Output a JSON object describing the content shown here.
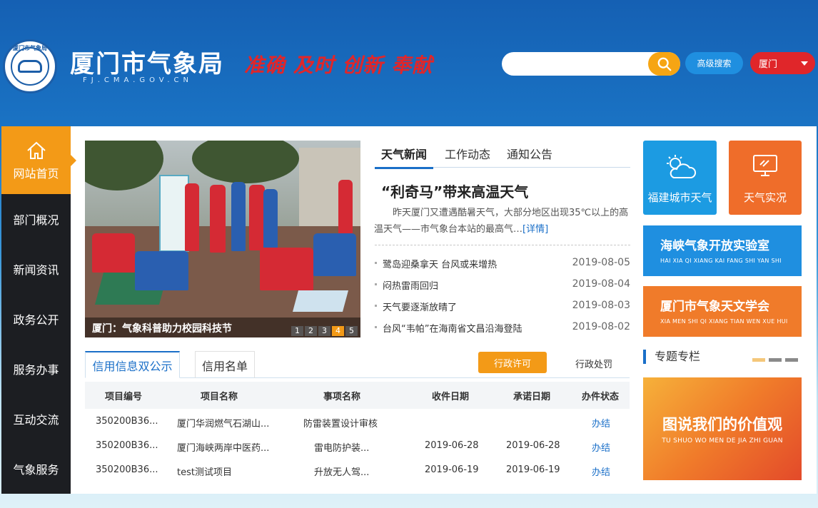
{
  "header": {
    "logo_ring_text": "厦门市气象局",
    "title": "厦门市气象局",
    "domain": "FJ.CMA.GOV.CN",
    "slogan": "准确 及时 创新 奉献",
    "search": {
      "placeholder": "",
      "value": ""
    },
    "advanced_search_label": "高级搜索",
    "city_selector": "厦门"
  },
  "sidebar": {
    "items": [
      {
        "label": "网站首页"
      },
      {
        "label": "部门概况"
      },
      {
        "label": "新闻资讯"
      },
      {
        "label": "政务公开"
      },
      {
        "label": "服务办事"
      },
      {
        "label": "互动交流"
      },
      {
        "label": "气象服务"
      }
    ]
  },
  "slider": {
    "caption": "厦门：气象科普助力校园科技节",
    "pages": [
      "1",
      "2",
      "3",
      "4",
      "5"
    ],
    "active_page": 4
  },
  "news": {
    "tabs": [
      "天气新闻",
      "工作动态",
      "通知公告"
    ],
    "headline": "“利奇马”带来高温天气",
    "summary": "昨天厦门又遭遇酷暑天气，大部分地区出现35℃以上的高温天气——市气象台本站的最高气…",
    "more_label": "[详情]",
    "items": [
      {
        "title": "鹭岛迎桑拿天 台风或来增热",
        "date": "2019-08-05"
      },
      {
        "title": "闷热雷雨回归",
        "date": "2019-08-04"
      },
      {
        "title": "天气要逐渐放晴了",
        "date": "2019-08-03"
      },
      {
        "title": "台风“韦帕”在海南省文昌沿海登陆",
        "date": "2019-08-02"
      }
    ]
  },
  "credit": {
    "tabs": [
      "信用信息双公示",
      "信用名单"
    ],
    "permit_button": "行政许可",
    "punish_link": "行政处罚",
    "columns": [
      "项目编号",
      "项目名称",
      "事项名称",
      "收件日期",
      "承诺日期",
      "办件状态"
    ],
    "rows": [
      [
        "350200B36...",
        "厦门华润燃气石湖山...",
        "防雷装置设计审核",
        "",
        "",
        "办结"
      ],
      [
        "350200B36...",
        "厦门海峡两岸中医药...",
        "雷电防护装...",
        "2019-06-28",
        "2019-06-28",
        "办结"
      ],
      [
        "350200B36...",
        "test测试项目",
        "升放无人驾...",
        "2019-06-19",
        "2019-06-19",
        "办结"
      ]
    ]
  },
  "right": {
    "tiles": [
      {
        "label": "福建城市天气",
        "color": "#1c9be2",
        "icon": "weather-icon"
      },
      {
        "label": "天气实况",
        "color": "#ef6d2a",
        "icon": "monitor-icon"
      }
    ],
    "banners": [
      {
        "title": "海峡气象开放实验室",
        "sub": "HAI XIA QI XIANG KAI FANG SHI YAN SHI",
        "color": "#1f8fe0"
      },
      {
        "title": "厦门市气象天文学会",
        "sub": "XIA MEN SHI QI XIANG TIAN WEN XUE HUI",
        "color": "#f07b2a"
      }
    ],
    "special_title": "专题专栏",
    "promo_title": "图说我们的价值观",
    "promo_sub": "TU SHUO WO MEN DE JIA ZHI GUAN"
  },
  "colors": {
    "accent_orange": "#f39a17",
    "accent_blue": "#1a6fc8",
    "red": "#e0262a",
    "sidebar_dark": "#1c1e22"
  }
}
